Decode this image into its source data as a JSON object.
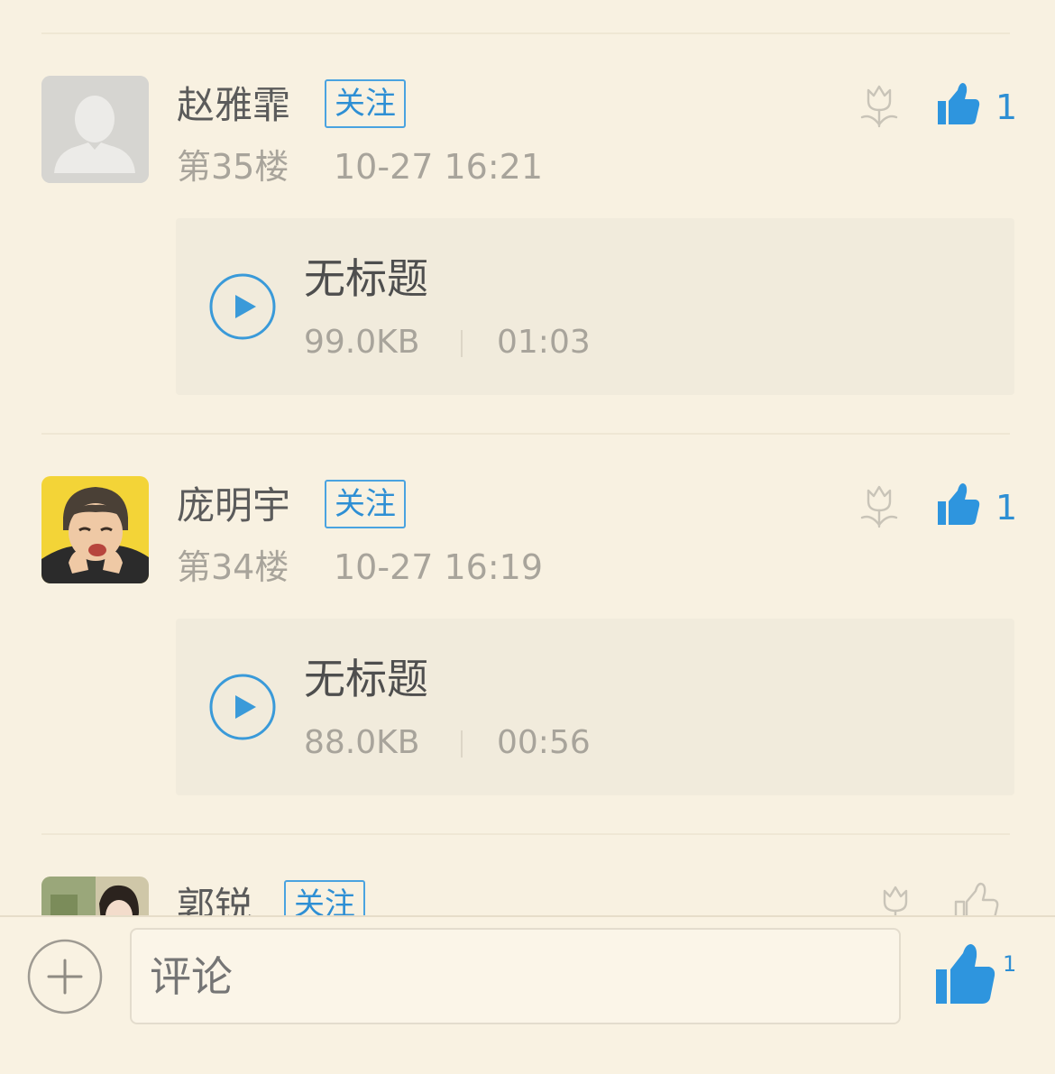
{
  "comments": [
    {
      "username": "赵雅霏",
      "follow_label": "关注",
      "floor": "第35楼",
      "time": "10-27 16:21",
      "like_count": "1",
      "voice": {
        "title": "无标题",
        "size": "99.0KB",
        "duration": "01:03"
      }
    },
    {
      "username": "庞明宇",
      "follow_label": "关注",
      "floor": "第34楼",
      "time": "10-27 16:19",
      "like_count": "1",
      "voice": {
        "title": "无标题",
        "size": "88.0KB",
        "duration": "00:56"
      }
    },
    {
      "username": "郭锐",
      "follow_label": "关注"
    }
  ],
  "bottom_bar": {
    "comment_placeholder": "评论",
    "like_count": "1"
  },
  "icons": {
    "flower": "flower-icon",
    "like": "thumbs-up-icon",
    "play": "play-icon",
    "add": "plus-circle-icon"
  },
  "colors": {
    "background": "#f8f1e1",
    "accent": "#2e8fd4",
    "muted_text": "#a8a49b"
  }
}
